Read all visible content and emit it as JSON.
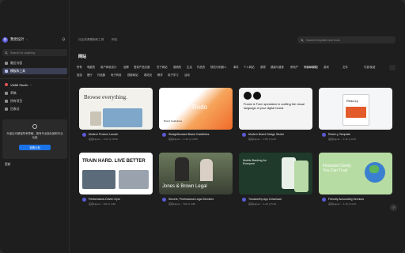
{
  "sidebar": {
    "team_name": "我觉设计",
    "search_placeholder": "Search for anything",
    "nav": [
      {
        "label": "最近内容",
        "active": false
      },
      {
        "label": "模板和工具",
        "active": true
      }
    ],
    "workspace": {
      "name": "VisBit Studio",
      "items": [
        {
          "label": "草稿"
        },
        {
          "label": "所有项目"
        },
        {
          "label": "回收站"
        }
      ]
    },
    "upgrade": {
      "text": "升级后可解锁所有草稿、拥有专业版社团和专业功能",
      "button": "查看计划"
    },
    "bottom_item": "更新"
  },
  "topbar": {
    "tabs": [
      "社区资源模版和工具",
      "网站"
    ],
    "search_placeholder": "Search templates and tools"
  },
  "page": {
    "title": "网站",
    "chips": [
      "所有",
      "电脑的",
      "用户体验设计",
      "品牌",
      "登录产品页面",
      "关于网站",
      "营销的",
      "生活",
      "作品的",
      "规范与机器人",
      "事件",
      "个人网站",
      "食物",
      "健康与健身",
      "房地产",
      "软件和服务",
      "游戏",
      "旅游",
      "餐厅",
      "作品集",
      "电子商务",
      "视频网站",
      "着陆页",
      "教学",
      "电子学习",
      "活动"
    ],
    "filters": [
      "Figma 网站",
      "文件",
      "付费/免费"
    ]
  },
  "cards": [
    {
      "title": "Modern Product Launch",
      "by": "来自Figma",
      "likes": "3.2K",
      "views": "18.6K",
      "theme": "browse",
      "thumb_text": "Browse everything."
    },
    {
      "title": "Straightforward Brand Guidelines",
      "by": "来自Figma",
      "likes": "4.4K",
      "views": "13.8K",
      "theme": "redo",
      "thumb_text": "Redo",
      "thumb_sub": "Brand Guidelines"
    },
    {
      "title": "Modern Brand Design Studio",
      "by": "来自Figma",
      "likes": "2.5K",
      "views": "9.4K",
      "theme": "studio",
      "thumb_text": "Frame & Form specialize in crafting the visual language of your digital brand."
    },
    {
      "title": "Read.Ly Template",
      "by": "来自Figma",
      "likes": "2.1K",
      "views": "8.4K",
      "theme": "readly",
      "thumb_text": "Read.Ly"
    },
    {
      "title": "Performance-Driven Gym",
      "by": "来自Figma",
      "likes": "423",
      "views": "4.9K",
      "theme": "gym",
      "thumb_text": "TRAIN HARD. LIVE BETTER"
    },
    {
      "title": "Sincere, Professional Legal Services",
      "by": "来自Figma",
      "likes": "516",
      "views": "4.8K",
      "theme": "legal",
      "thumb_text": "Jones & Brown Legal"
    },
    {
      "title": "Trustworthy App Download",
      "by": "来自Figma",
      "likes": "1.2K",
      "views": "5.1K",
      "theme": "app",
      "thumb_text": "Mobile Banking for Everyone"
    },
    {
      "title": "Friendly Accounting Services",
      "by": "来自Figma",
      "likes": "1.1K",
      "views": "3.4K",
      "theme": "acct",
      "thumb_text": "Financial Clarity You Can Trust"
    }
  ],
  "help_label": "?",
  "colors": {
    "accent": "#1a73e8",
    "sidebar_active": "#3b3f54",
    "background": "#1e1e1e"
  }
}
